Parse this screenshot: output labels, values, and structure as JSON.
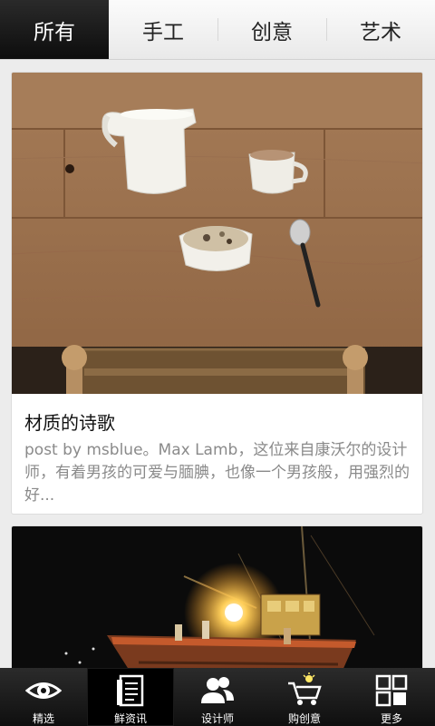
{
  "tabs": [
    {
      "label": "所有",
      "active": true
    },
    {
      "label": "手工",
      "active": false
    },
    {
      "label": "创意",
      "active": false
    },
    {
      "label": "艺术",
      "active": false
    }
  ],
  "feed": {
    "articles": [
      {
        "title": "材质的诗歌",
        "summary": "post by msblue。Max Lamb，这位来自康沃尔的设计师，有着男孩的可爱与腼腆，也像一个男孩般，用强烈的好...",
        "image": "ceramic-tableware-photo"
      },
      {
        "title": "",
        "summary": "",
        "image": "night-fishing-boat-photo"
      }
    ]
  },
  "bottom_nav": [
    {
      "label": "精选",
      "icon": "eye-icon",
      "active": false
    },
    {
      "label": "鲜资讯",
      "icon": "news-icon",
      "active": true
    },
    {
      "label": "设计师",
      "icon": "people-icon",
      "active": false
    },
    {
      "label": "购创意",
      "icon": "cart-icon",
      "active": false
    },
    {
      "label": "更多",
      "icon": "grid-icon",
      "active": false
    }
  ]
}
